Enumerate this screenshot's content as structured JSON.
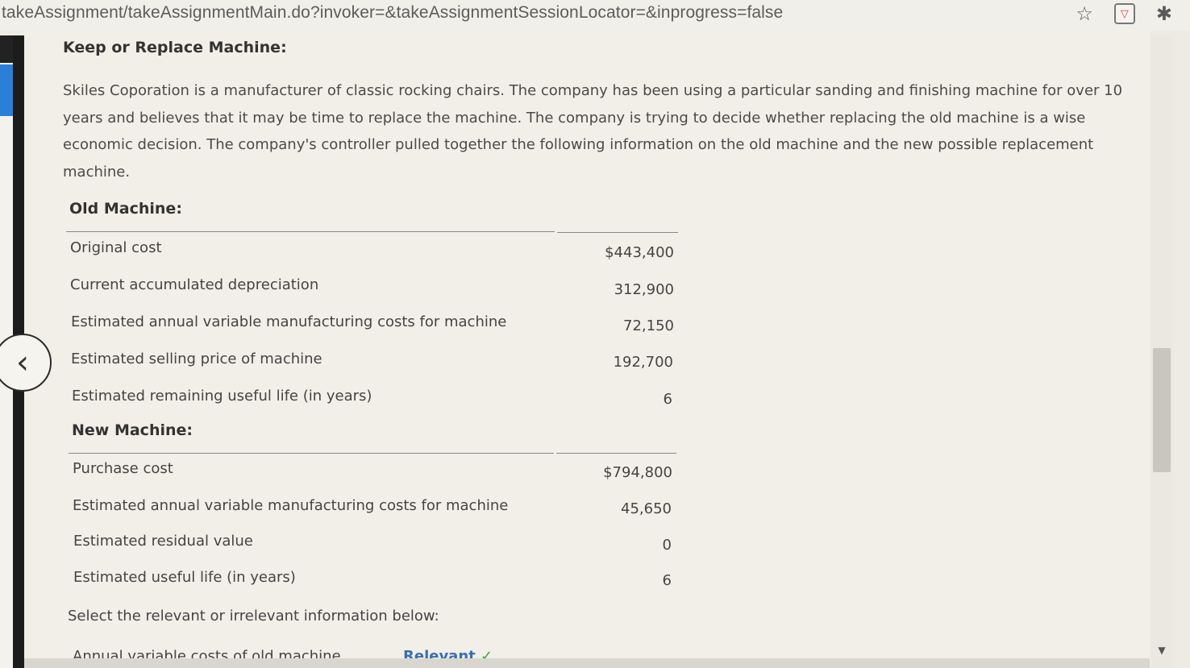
{
  "browser": {
    "url": "takeAssignment/takeAssignmentMain.do?invoker=&takeAssignmentSessionLocator=&inprogress=false",
    "icons": [
      "star-icon",
      "pocket-icon",
      "extensions-icon"
    ]
  },
  "page": {
    "heading": "Keep or Replace Machine:",
    "intro": "Skiles Coporation is a manufacturer of classic rocking chairs. The company has been using a particular sanding and finishing machine for over 10 years and believes that it may be time to replace the machine. The company is trying to decide whether replacing the old machine is a wise economic decision. The company's controller pulled together the following information on the old machine and the new possible replacement machine."
  },
  "old_machine": {
    "title": "Old Machine:",
    "rows": [
      {
        "label": "Original cost",
        "value": "$443,400"
      },
      {
        "label": "Current accumulated depreciation",
        "value": "312,900"
      },
      {
        "label": "Estimated annual variable manufacturing costs for machine",
        "value": "72,150"
      },
      {
        "label": "Estimated selling price of machine",
        "value": "192,700"
      },
      {
        "label": "Estimated remaining useful life (in years)",
        "value": "6"
      }
    ]
  },
  "new_machine": {
    "title": "New Machine:",
    "rows": [
      {
        "label": "Purchase cost",
        "value": "$794,800"
      },
      {
        "label": "Estimated annual variable manufacturing costs for machine",
        "value": "45,650"
      },
      {
        "label": "Estimated residual value",
        "value": "0"
      },
      {
        "label": "Estimated useful life (in years)",
        "value": "6"
      }
    ]
  },
  "question": {
    "prompt": "Select the relevant or irrelevant information below:",
    "first_item_label": "Annual variable costs of old machine",
    "first_item_answer": "Relevant",
    "check_mark": "✓"
  }
}
